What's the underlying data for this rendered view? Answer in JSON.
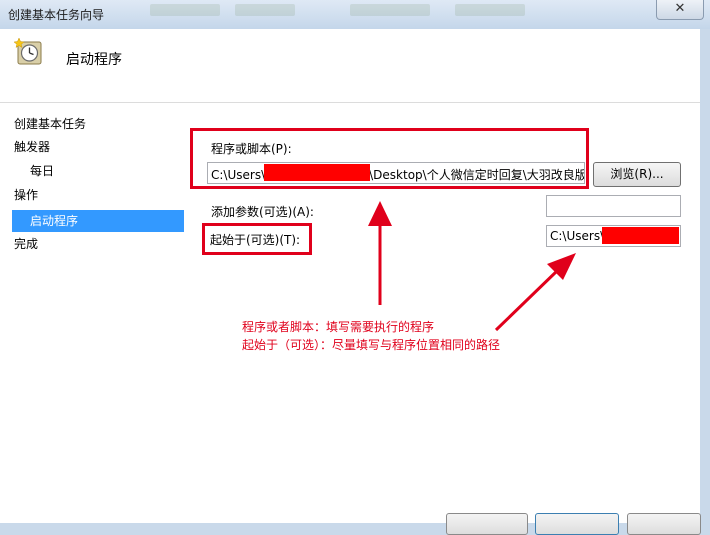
{
  "window": {
    "title": "创建基本任务向导",
    "close_glyph": "✕"
  },
  "header": {
    "title": "启动程序",
    "icon": "clock-icon"
  },
  "sidebar": {
    "items": [
      {
        "label": "创建基本任务",
        "active": false
      },
      {
        "label": "触发器",
        "active": false
      },
      {
        "label": "每日",
        "active": false
      },
      {
        "label": "操作",
        "active": false
      },
      {
        "label": "启动程序",
        "active": true
      },
      {
        "label": "完成",
        "active": false
      }
    ]
  },
  "form": {
    "program_label": "程序或脚本(P):",
    "program_value_prefix": "C:\\Users\\",
    "program_value_suffix": "\\Desktop\\个人微信定时回复\\大羽改良版",
    "browse_label": "浏览(R)...",
    "args_label": "添加参数(可选)(A):",
    "args_value": "",
    "start_label": "起始于(可选)(T):",
    "start_value": "C:\\Users\\"
  },
  "annotation": {
    "line1": "程序或者脚本：填写需要执行的程序",
    "line2": "起始于（可选）：尽量填写与程序位置相同的路径",
    "color": "#e0001b"
  },
  "colors": {
    "selection": "#3399ff",
    "window_frame": "#c9d9ea"
  }
}
